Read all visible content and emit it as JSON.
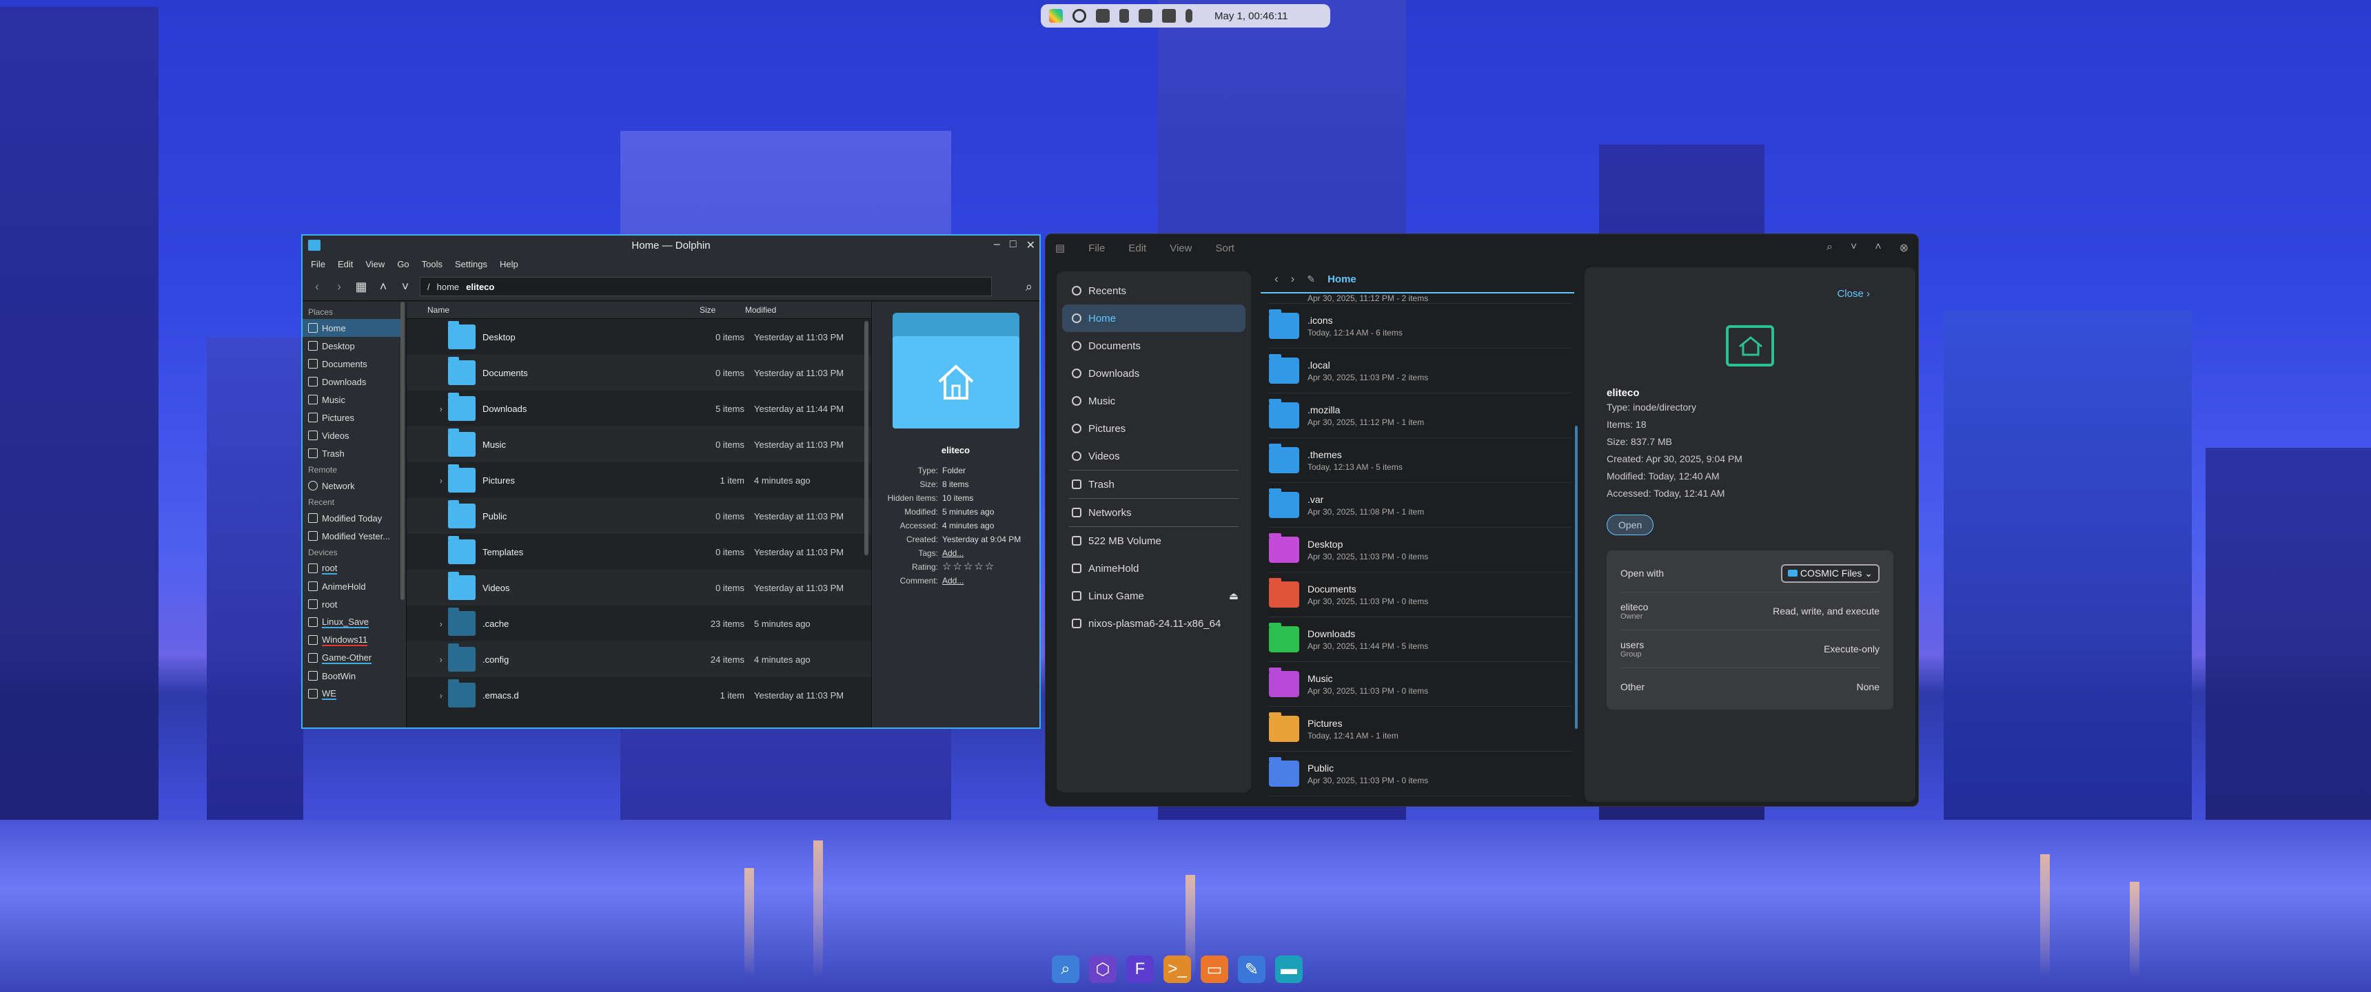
{
  "top_panel": {
    "clock": "May 1, 00:46:11"
  },
  "dolphin": {
    "title": "Home — Dolphin",
    "menu": [
      "File",
      "Edit",
      "View",
      "Go",
      "Tools",
      "Settings",
      "Help"
    ],
    "breadcrumb": {
      "root": "/",
      "seg1": "home",
      "current": "eliteco"
    },
    "places": {
      "places_header": "Places",
      "places": [
        "Home",
        "Desktop",
        "Documents",
        "Downloads",
        "Music",
        "Pictures",
        "Videos",
        "Trash"
      ],
      "remote_header": "Remote",
      "remote": [
        "Network"
      ],
      "recent_header": "Recent",
      "recent": [
        "Modified Today",
        "Modified Yester..."
      ],
      "devices_header": "Devices",
      "devices": [
        "root",
        "AnimeHold",
        "root",
        "Linux_Save",
        "Windows11",
        "Game-Other",
        "BootWin",
        "WE"
      ]
    },
    "columns": {
      "name": "Name",
      "size": "Size",
      "modified": "Modified"
    },
    "files": [
      {
        "name": "Desktop",
        "size": "0 items",
        "modified": "Yesterday at 11:03 PM",
        "expand": false
      },
      {
        "name": "Documents",
        "size": "0 items",
        "modified": "Yesterday at 11:03 PM",
        "expand": false
      },
      {
        "name": "Downloads",
        "size": "5 items",
        "modified": "Yesterday at 11:44 PM",
        "expand": true
      },
      {
        "name": "Music",
        "size": "0 items",
        "modified": "Yesterday at 11:03 PM",
        "expand": false
      },
      {
        "name": "Pictures",
        "size": "1 item",
        "modified": "4 minutes ago",
        "expand": true
      },
      {
        "name": "Public",
        "size": "0 items",
        "modified": "Yesterday at 11:03 PM",
        "expand": false
      },
      {
        "name": "Templates",
        "size": "0 items",
        "modified": "Yesterday at 11:03 PM",
        "expand": false
      },
      {
        "name": "Videos",
        "size": "0 items",
        "modified": "Yesterday at 11:03 PM",
        "expand": false
      },
      {
        "name": ".cache",
        "size": "23 items",
        "modified": "5 minutes ago",
        "expand": true
      },
      {
        "name": ".config",
        "size": "24 items",
        "modified": "4 minutes ago",
        "expand": true
      },
      {
        "name": ".emacs.d",
        "size": "1 item",
        "modified": "Yesterday at 11:03 PM",
        "expand": true
      }
    ],
    "info": {
      "name": "eliteco",
      "type_label": "Type:",
      "type": "Folder",
      "size_label": "Size:",
      "size": "8 items",
      "hidden_label": "Hidden items:",
      "hidden": "10 items",
      "modified_label": "Modified:",
      "modified": "5 minutes ago",
      "accessed_label": "Accessed:",
      "accessed": "4 minutes ago",
      "created_label": "Created:",
      "created": "Yesterday at 9:04 PM",
      "tags_label": "Tags:",
      "tags": "Add...",
      "rating_label": "Rating:",
      "rating": "☆☆☆☆☆",
      "comment_label": "Comment:",
      "comment": "Add..."
    }
  },
  "cosmic": {
    "menu": [
      "File",
      "Edit",
      "View",
      "Sort"
    ],
    "location": "Home",
    "sidebar": [
      {
        "label": "Recents"
      },
      {
        "label": "Home",
        "selected": true
      },
      {
        "label": "Documents"
      },
      {
        "label": "Downloads"
      },
      {
        "label": "Music"
      },
      {
        "label": "Pictures"
      },
      {
        "label": "Videos"
      },
      {
        "label": "Trash"
      },
      {
        "label": "Networks"
      },
      {
        "label": "522 MB Volume"
      },
      {
        "label": "AnimeHold"
      },
      {
        "label": "Linux Game"
      },
      {
        "label": "nixos-plasma6-24.11-x86_64"
      }
    ],
    "top_partial": "Apr 30, 2025, 11:12 PM - 2 items",
    "items": [
      {
        "name": ".icons",
        "meta": "Today, 12:14 AM - 6 items",
        "color": "#3399e6"
      },
      {
        "name": ".local",
        "meta": "Apr 30, 2025, 11:03 PM - 2 items",
        "color": "#3399e6"
      },
      {
        "name": ".mozilla",
        "meta": "Apr 30, 2025, 11:12 PM - 1 item",
        "color": "#3399e6"
      },
      {
        "name": ".themes",
        "meta": "Today, 12:13 AM - 5 items",
        "color": "#3399e6"
      },
      {
        "name": ".var",
        "meta": "Apr 30, 2025, 11:08 PM - 1 item",
        "color": "#3399e6"
      },
      {
        "name": "Desktop",
        "meta": "Apr 30, 2025, 11:03 PM - 0 items",
        "color": "#c44ad8"
      },
      {
        "name": "Documents",
        "meta": "Apr 30, 2025, 11:03 PM - 0 items",
        "color": "#e0553a"
      },
      {
        "name": "Downloads",
        "meta": "Apr 30, 2025, 11:44 PM - 5 items",
        "color": "#2bbf4e"
      },
      {
        "name": "Music",
        "meta": "Apr 30, 2025, 11:03 PM - 0 items",
        "color": "#b84ad8"
      },
      {
        "name": "Pictures",
        "meta": "Today, 12:41 AM - 1 item",
        "color": "#e9a23a"
      },
      {
        "name": "Public",
        "meta": "Apr 30, 2025, 11:03 PM - 0 items",
        "color": "#4a7ee9"
      }
    ],
    "details": {
      "close": "Close",
      "name": "eliteco",
      "type": "Type: inode/directory",
      "items": "Items: 18",
      "size": "Size: 837.7 MB",
      "created": "Created: Apr 30, 2025, 9:04 PM",
      "modified": "Modified: Today, 12:40 AM",
      "accessed": "Accessed: Today, 12:41 AM",
      "open": "Open",
      "open_with": "Open with",
      "open_with_app": "COSMIC Files",
      "owner_name": "eliteco",
      "owner_role": "Owner",
      "owner_perm": "Read, write, and execute",
      "group_name": "users",
      "group_role": "Group",
      "group_perm": "Execute-only",
      "other_name": "Other",
      "other_perm": "None"
    }
  },
  "dock_items": [
    "search-icon",
    "hexagon-app-icon",
    "files-app-icon",
    "terminal-icon",
    "folder-icon",
    "editor-icon",
    "window-icon"
  ]
}
